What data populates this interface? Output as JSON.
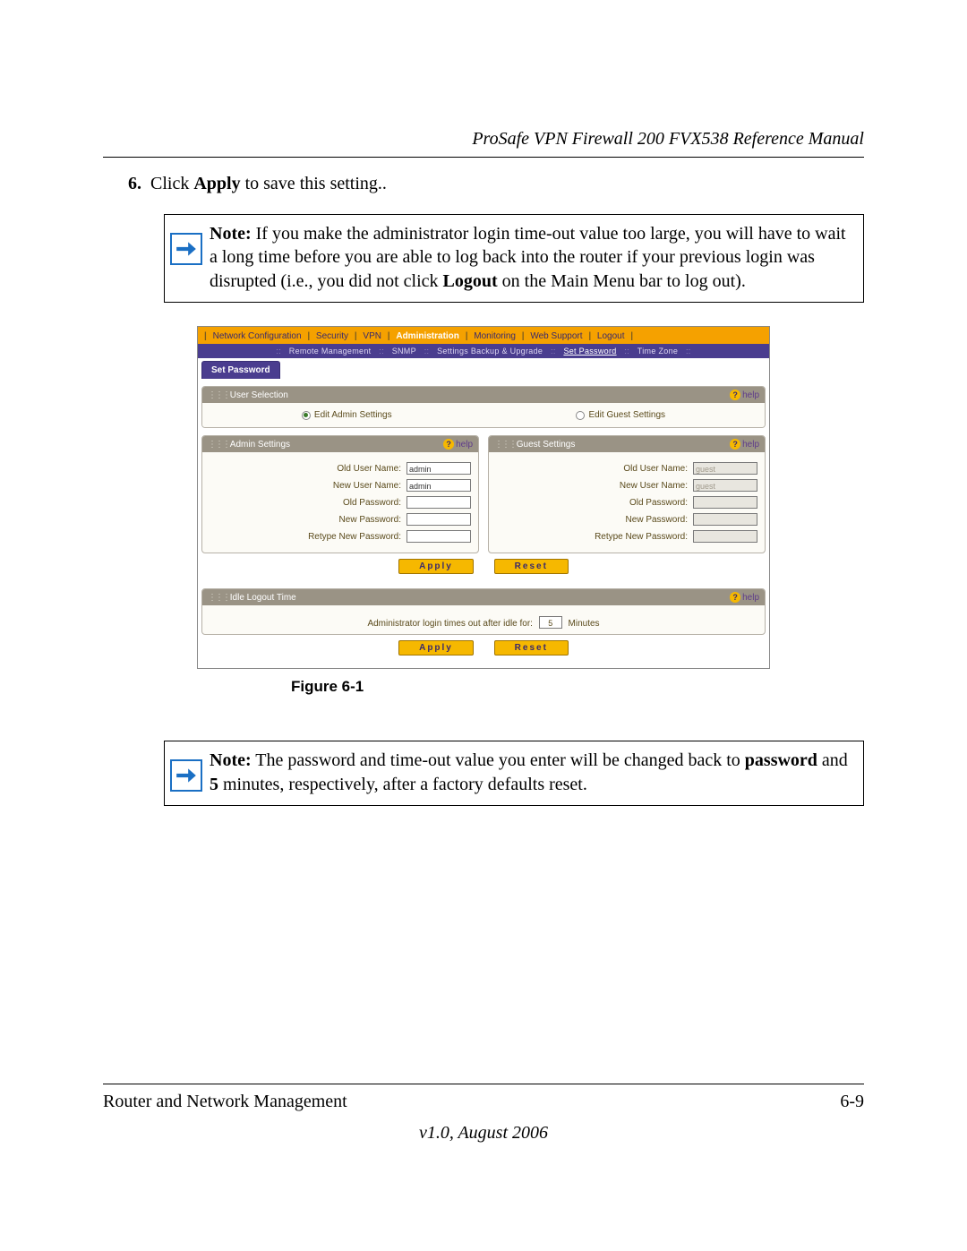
{
  "header_title": "ProSafe VPN Firewall 200 FVX538 Reference Manual",
  "step": {
    "number": "6.",
    "prefix": "Click ",
    "bold": "Apply",
    "suffix": " to save this setting.."
  },
  "note1": {
    "label": "Note:",
    "text_part1": " If you make the administrator login time-out value too large, you will have to wait a long time before you are able to log back into the router if your previous login was disrupted (i.e., you did not click ",
    "bold1": "Logout",
    "text_part2": " on the Main Menu bar to log out)."
  },
  "nav": {
    "items": [
      {
        "label": "Network Configuration",
        "active": false
      },
      {
        "label": "Security",
        "active": false
      },
      {
        "label": "VPN",
        "active": false
      },
      {
        "label": "Administration",
        "active": true
      },
      {
        "label": "Monitoring",
        "active": false
      },
      {
        "label": "Web Support",
        "active": false
      },
      {
        "label": "Logout",
        "active": false
      }
    ]
  },
  "subnav": {
    "items": [
      {
        "label": "Remote Management",
        "active": false
      },
      {
        "label": "SNMP",
        "active": false
      },
      {
        "label": "Settings Backup & Upgrade",
        "active": false
      },
      {
        "label": "Set Password",
        "active": true
      },
      {
        "label": "Time Zone",
        "active": false
      }
    ]
  },
  "tab_label": "Set Password",
  "help_label": "help",
  "panels": {
    "user_selection": {
      "title": "User Selection",
      "radio_admin": "Edit Admin Settings",
      "radio_guest": "Edit Guest Settings"
    },
    "admin": {
      "title": "Admin Settings",
      "fields": {
        "old_user": {
          "label": "Old User Name:",
          "value": "admin"
        },
        "new_user": {
          "label": "New User Name:",
          "value": "admin"
        },
        "old_pw": {
          "label": "Old Password:",
          "value": ""
        },
        "new_pw": {
          "label": "New Password:",
          "value": ""
        },
        "retype": {
          "label": "Retype New Password:",
          "value": ""
        }
      }
    },
    "guest": {
      "title": "Guest Settings",
      "fields": {
        "old_user": {
          "label": "Old User Name:",
          "value": "guest"
        },
        "new_user": {
          "label": "New User Name:",
          "value": "guest"
        },
        "old_pw": {
          "label": "Old Password:",
          "value": ""
        },
        "new_pw": {
          "label": "New Password:",
          "value": ""
        },
        "retype": {
          "label": "Retype New Password:",
          "value": ""
        }
      }
    },
    "idle": {
      "title": "Idle Logout Time",
      "text_before": "Administrator login times out after idle for:",
      "value": "5",
      "text_after": "Minutes"
    }
  },
  "buttons": {
    "apply": "Apply",
    "reset": "Reset"
  },
  "figure_label": "Figure 6-1",
  "note2": {
    "label": "Note:",
    "t1": " The password and time-out value you enter will be changed back to ",
    "b1": "password",
    "t2": " and ",
    "b2": "5",
    "t3": " minutes, respectively, after a factory defaults reset."
  },
  "footer": {
    "left": "Router and Network Management",
    "right": "6-9",
    "version": "v1.0, August 2006"
  }
}
